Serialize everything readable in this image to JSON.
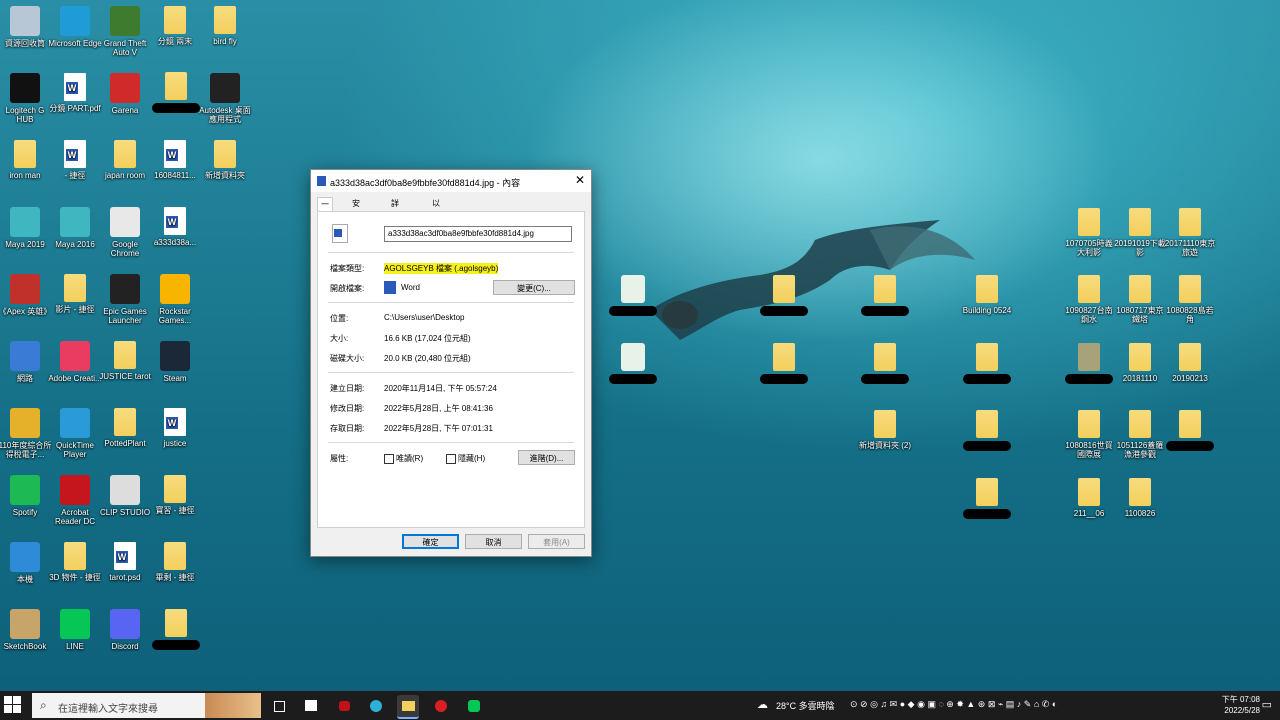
{
  "desktop": {
    "icons": [
      {
        "label": "資源回收筒",
        "x": 0,
        "y": 0,
        "kind": "recycle"
      },
      {
        "label": "Microsoft Edge",
        "kind": "edge"
      },
      {
        "label": "Grand Theft Auto V",
        "kind": "gta"
      },
      {
        "label": "分鏡 兩末",
        "kind": "folder"
      },
      {
        "label": "bird fly",
        "kind": "folder"
      },
      {
        "label": "Logitech G HUB",
        "kind": "ghub"
      },
      {
        "label": "分鏡 PART.pdf",
        "kind": "doc"
      },
      {
        "label": "Garena",
        "kind": "garena"
      },
      {
        "label": "Autodesk 桌面應用程式",
        "kind": "autodesk"
      },
      {
        "label": "iron man",
        "kind": "folder"
      },
      {
        "label": "- 捷徑",
        "kind": "doc"
      },
      {
        "label": "japan room",
        "kind": "folder"
      },
      {
        "label": "16084811...",
        "kind": "doc"
      },
      {
        "label": "新增資料夾",
        "kind": "folder"
      },
      {
        "label": "Maya 2019",
        "kind": "maya"
      },
      {
        "label": "Maya 2016",
        "kind": "maya"
      },
      {
        "label": "Google Chrome",
        "kind": "chrome"
      },
      {
        "label": "a333d38a...",
        "kind": "doc"
      },
      {
        "label": "《Apex 英雄》",
        "kind": "apex"
      },
      {
        "label": "影片 - 捷徑",
        "kind": "folder"
      },
      {
        "label": "Epic Games Launcher",
        "kind": "epic"
      },
      {
        "label": "Rockstar Games...",
        "kind": "rockstar"
      },
      {
        "label": "網路",
        "kind": "network"
      },
      {
        "label": "Adobe Creati...",
        "kind": "adobe"
      },
      {
        "label": "JUSTICE tarot",
        "kind": "folder"
      },
      {
        "label": "Steam",
        "kind": "steam"
      },
      {
        "label": "110年度綜合所得稅電子...",
        "kind": "tax"
      },
      {
        "label": "QuickTime Player",
        "kind": "quicktime"
      },
      {
        "label": "PottedPlant",
        "kind": "folder"
      },
      {
        "label": "justice",
        "kind": "doc"
      },
      {
        "label": "Spotify",
        "kind": "spotify"
      },
      {
        "label": "Acrobat Reader DC",
        "kind": "acrobat"
      },
      {
        "label": "CLIP STUDIO",
        "kind": "clip"
      },
      {
        "label": "寶習 - 捷徑",
        "kind": "folder"
      },
      {
        "label": "本機",
        "kind": "pc"
      },
      {
        "label": "3D 物件 - 捷徑",
        "kind": "folder"
      },
      {
        "label": "tarot.psd",
        "kind": "doc"
      },
      {
        "label": "畢剩 - 捷徑",
        "kind": "folder"
      },
      {
        "label": "SketchBook",
        "kind": "sketchbook"
      },
      {
        "label": "LINE",
        "kind": "line"
      },
      {
        "label": "Discord",
        "kind": "discord"
      }
    ],
    "right_icons": [
      {
        "label": "1070705時義大利影"
      },
      {
        "label": "20191019下載影"
      },
      {
        "label": "20171110東京旅遊"
      },
      {
        "label": "Building 0524"
      },
      {
        "label": "1090827台南鋼水"
      },
      {
        "label": "1080717東京鐵塔"
      },
      {
        "label": "1080828島若角"
      },
      {
        "label": "20181110"
      },
      {
        "label": "20190213"
      },
      {
        "label": "新增資料夾 (2)"
      },
      {
        "label": "1080816世貿國際展"
      },
      {
        "label": "1051126蓋羅漁港參觀"
      },
      {
        "label": "211__06"
      },
      {
        "label": "1100826"
      }
    ]
  },
  "dialog": {
    "title": "a333d38ac3df0ba8e9fbbfe30fd881d4.jpg - 內容",
    "tabs": [
      "一般",
      "安全性",
      "詳細資料",
      "以前的版本"
    ],
    "filename": "a333d38ac3df0ba8e9fbbfe30fd881d4.jpg",
    "file_type_label": "檔案類型:",
    "file_type_value": "AGOLSGEYB 檔案 (.agolsgeyb)",
    "open_with_label": "開啟檔案:",
    "open_with_value": "Word",
    "change_button": "變更(C)...",
    "location_label": "位置:",
    "location_value": "C:\\Users\\user\\Desktop",
    "size_label": "大小:",
    "size_value": "16.6 KB (17,024 位元組)",
    "disk_size_label": "磁碟大小:",
    "disk_size_value": "20.0 KB (20,480 位元組)",
    "created_label": "建立日期:",
    "created_value": "2020年11月14日, 下午 05:57:24",
    "modified_label": "修改日期:",
    "modified_value": "2022年5月28日, 上午 08:41:36",
    "accessed_label": "存取日期:",
    "accessed_value": "2022年5月28日, 下午 07:01:31",
    "attributes_label": "屬性:",
    "readonly_label": "唯讀(R)",
    "hidden_label": "隱藏(H)",
    "advanced_button": "進階(D)...",
    "ok_button": "確定",
    "cancel_button": "取消",
    "apply_button": "套用(A)"
  },
  "taskbar": {
    "search_placeholder": "在這裡輸入文字來搜尋",
    "weather": "28°C 多雲時陰",
    "time": "下午 07:08",
    "date": "2022/5/28"
  }
}
